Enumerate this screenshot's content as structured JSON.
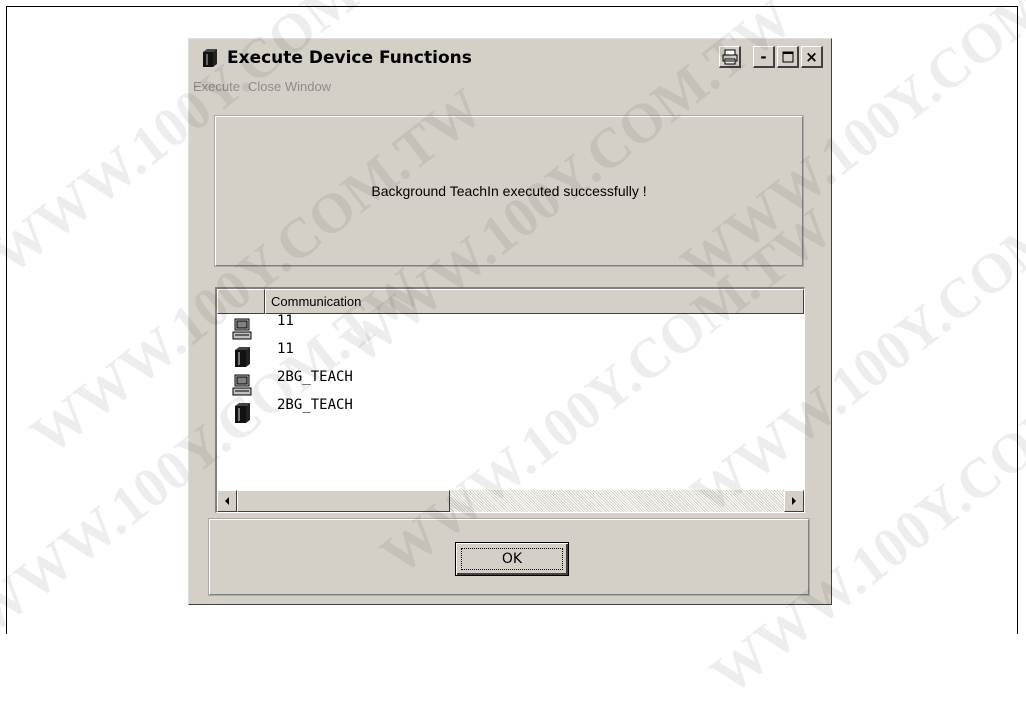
{
  "window": {
    "title": "Execute Device Functions",
    "controls": {
      "minimize": "-",
      "close": "×"
    }
  },
  "menu": {
    "items": [
      {
        "label": "Execute"
      },
      {
        "label": "Close Window"
      }
    ]
  },
  "message": "Background TeachIn executed successfully !",
  "list": {
    "header": "Communication",
    "rows": [
      {
        "icon": "computer-icon",
        "label": "11"
      },
      {
        "icon": "device-block-icon",
        "label": "11"
      },
      {
        "icon": "computer-icon",
        "label": "2BG_TEACH"
      },
      {
        "icon": "device-block-icon",
        "label": "2BG_TEACH"
      }
    ]
  },
  "ok_label": "OK",
  "watermark": "WWW.100Y.COM.TW"
}
